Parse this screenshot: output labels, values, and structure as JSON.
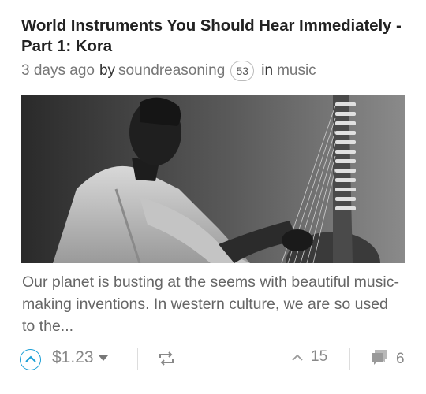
{
  "post": {
    "title_line1": "World Instruments You Should Hear Immediately -",
    "title_line2": "Part 1: Kora",
    "time_ago": "3 days ago",
    "by": "by",
    "author": "soundreasoning",
    "reputation": "53",
    "in": "in",
    "category": "music",
    "excerpt": "Our planet is busting at the seems with beautiful music-making inventions. In western culture, we are so used to the..."
  },
  "footer": {
    "payout": "$1.23",
    "votes": "15",
    "comments": "6"
  },
  "icons": {
    "upvote": "chevron-up-circle-icon",
    "payout_menu": "caret-down-icon",
    "reblog": "reblog-icon",
    "votes": "chevron-up-icon",
    "comments": "comment-bubble-icon"
  },
  "colors": {
    "accent": "#1a9fd6"
  }
}
